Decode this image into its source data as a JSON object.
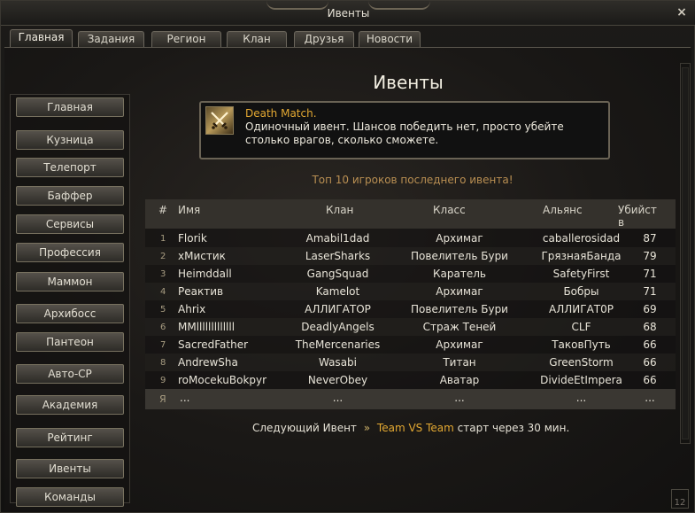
{
  "window": {
    "title": "Ивенты",
    "close_glyph": "×"
  },
  "tabs": [
    {
      "label": "Главная",
      "active": true
    },
    {
      "label": "Задания",
      "active": false
    },
    {
      "label": "Регион",
      "active": false
    },
    {
      "label": "Клан",
      "active": false
    },
    {
      "label": "Друзья",
      "active": false
    },
    {
      "label": "Новости",
      "active": false
    }
  ],
  "sidebar": {
    "items": [
      {
        "label": "Главная"
      },
      {
        "label": "Кузница"
      },
      {
        "label": "Телепорт"
      },
      {
        "label": "Баффер"
      },
      {
        "label": "Сервисы"
      },
      {
        "label": "Профессия"
      },
      {
        "label": "Маммон"
      },
      {
        "label": "Архибосс"
      },
      {
        "label": "Пантеон"
      },
      {
        "label": "Авто-СР"
      },
      {
        "label": "Академия"
      },
      {
        "label": "Рейтинг"
      },
      {
        "label": "Ивенты"
      },
      {
        "label": "Команды"
      }
    ]
  },
  "main": {
    "title": "Ивенты",
    "event": {
      "icon": "crossed-swords-icon",
      "name": "Death Match.",
      "description": " Одиночный ивент. Шансов победить нет, просто убейте столько врагов, сколько сможете."
    },
    "top_caption": "Топ 10 игроков последнего ивента!",
    "table": {
      "headers": [
        "#",
        "Имя",
        "Клан",
        "Класс",
        "Альянс",
        "Убийст в"
      ],
      "rows": [
        [
          "1",
          "Florik",
          "Amabil1dad",
          "Архимаг",
          "caballerosidad",
          "87"
        ],
        [
          "2",
          "хМистик",
          "LaserSharks",
          "Повелитель Бури",
          "ГрязнаяБанда",
          "79"
        ],
        [
          "3",
          "Heimddall",
          "GangSquad",
          "Каратель",
          "SafetyFirst",
          "71"
        ],
        [
          "4",
          "Реактив",
          "Kamelot",
          "Архимаг",
          "Бобры",
          "71"
        ],
        [
          "5",
          "Ahrix",
          "АЛЛИГАТОР",
          "Повелитель Бури",
          "АЛЛИГАТ0Р",
          "69"
        ],
        [
          "6",
          "MMlllllllllllll",
          "DeadlyAngels",
          "Страж Теней",
          "CLF",
          "68"
        ],
        [
          "7",
          "SacredFather",
          "TheMercenaries",
          "Архимаг",
          "ТаковПуть",
          "66"
        ],
        [
          "8",
          "AndrewSha",
          "Wasabi",
          "Титан",
          "GreenStorm",
          "66"
        ],
        [
          "9",
          "roMocekuBokpyr",
          "NeverObey",
          "Аватар",
          "DivideEtImpera",
          "66"
        ],
        [
          "Я",
          "...",
          "...",
          "...",
          "...",
          "..."
        ]
      ]
    },
    "next_event": {
      "prefix": "Следующий Ивент",
      "arrow": "»",
      "event_name": "Team VS Team",
      "suffix": "старт через 30 мин."
    }
  },
  "corner_badge": "12"
}
